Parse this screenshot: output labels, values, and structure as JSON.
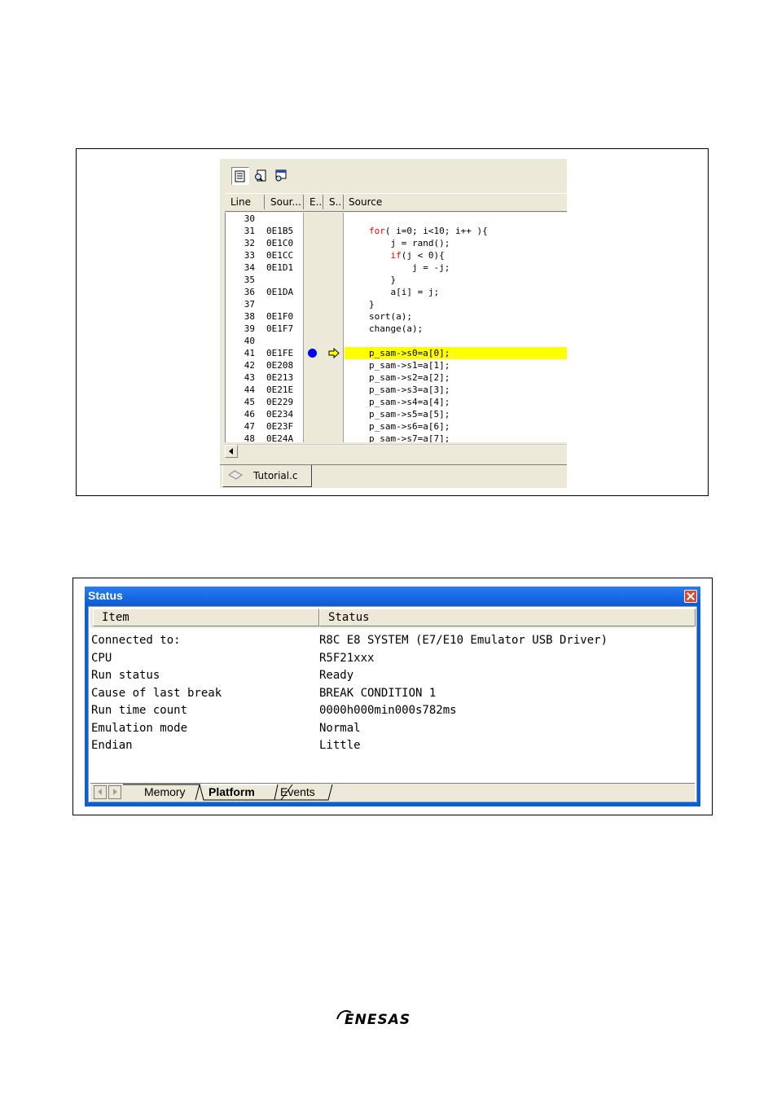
{
  "editor": {
    "columns": {
      "line": "Line",
      "source_addr": "Sour...",
      "event": "E...",
      "status": "S...",
      "source": "Source"
    },
    "rows": [
      {
        "line": "30",
        "addr": "",
        "code": "",
        "kw": "",
        "rest": ""
      },
      {
        "line": "31",
        "addr": "0E1B5",
        "code": "",
        "kw": "for",
        "rest": "( i=0; i<10; i++ ){"
      },
      {
        "line": "32",
        "addr": "0E1C0",
        "code": "    j = rand();",
        "kw": "",
        "rest": ""
      },
      {
        "line": "33",
        "addr": "0E1CC",
        "code": "    ",
        "kw": "if",
        "rest": "(j < 0){"
      },
      {
        "line": "34",
        "addr": "0E1D1",
        "code": "        j = -j;",
        "kw": "",
        "rest": ""
      },
      {
        "line": "35",
        "addr": "",
        "code": "    }",
        "kw": "",
        "rest": ""
      },
      {
        "line": "36",
        "addr": "0E1DA",
        "code": "    a[i] = j;",
        "kw": "",
        "rest": ""
      },
      {
        "line": "37",
        "addr": "",
        "code": "}",
        "kw": "",
        "rest": ""
      },
      {
        "line": "38",
        "addr": "0E1F0",
        "code": "sort(a);",
        "kw": "",
        "rest": ""
      },
      {
        "line": "39",
        "addr": "0E1F7",
        "code": "change(a);",
        "kw": "",
        "rest": ""
      },
      {
        "line": "40",
        "addr": "",
        "code": "",
        "kw": "",
        "rest": ""
      },
      {
        "line": "41",
        "addr": "0E1FE",
        "code": "p_sam->s0=a[0];",
        "kw": "",
        "rest": "",
        "breakpoint": true,
        "current": true
      },
      {
        "line": "42",
        "addr": "0E208",
        "code": "p_sam->s1=a[1];",
        "kw": "",
        "rest": ""
      },
      {
        "line": "43",
        "addr": "0E213",
        "code": "p_sam->s2=a[2];",
        "kw": "",
        "rest": ""
      },
      {
        "line": "44",
        "addr": "0E21E",
        "code": "p_sam->s3=a[3];",
        "kw": "",
        "rest": ""
      },
      {
        "line": "45",
        "addr": "0E229",
        "code": "p_sam->s4=a[4];",
        "kw": "",
        "rest": ""
      },
      {
        "line": "46",
        "addr": "0E234",
        "code": "p_sam->s5=a[5];",
        "kw": "",
        "rest": ""
      },
      {
        "line": "47",
        "addr": "0E23F",
        "code": "p_sam->s6=a[6];",
        "kw": "",
        "rest": ""
      },
      {
        "line": "48",
        "addr": "0E24A",
        "code": "p_sam->s7=a[7];",
        "kw": "",
        "rest": ""
      }
    ],
    "file_tab": "Tutorial.c",
    "colors": {
      "highlight": "#ffff00",
      "breakpoint": "#0000ff",
      "keyword": "#ff0000"
    },
    "toolbar_icons": [
      "source-view-icon",
      "disassembly-view-icon",
      "mixed-view-icon"
    ]
  },
  "status_window": {
    "title": "Status",
    "headers": {
      "item": "Item",
      "status": "Status"
    },
    "rows": [
      {
        "item": "Connected to:",
        "status": "R8C E8 SYSTEM (E7/E10 Emulator USB Driver)"
      },
      {
        "item": "CPU",
        "status": "R5F21xxx"
      },
      {
        "item": "Run status",
        "status": "Ready"
      },
      {
        "item": "Cause of last break",
        "status": "BREAK CONDITION 1"
      },
      {
        "item": "Run time count",
        "status": "0000h000min000s782ms"
      },
      {
        "item": "Emulation mode",
        "status": "Normal"
      },
      {
        "item": "Endian",
        "status": "Little"
      }
    ],
    "tabs": [
      "Memory",
      "Platform",
      "Events"
    ],
    "active_tab": "Platform"
  },
  "logo": {
    "text": "RENESAS"
  }
}
